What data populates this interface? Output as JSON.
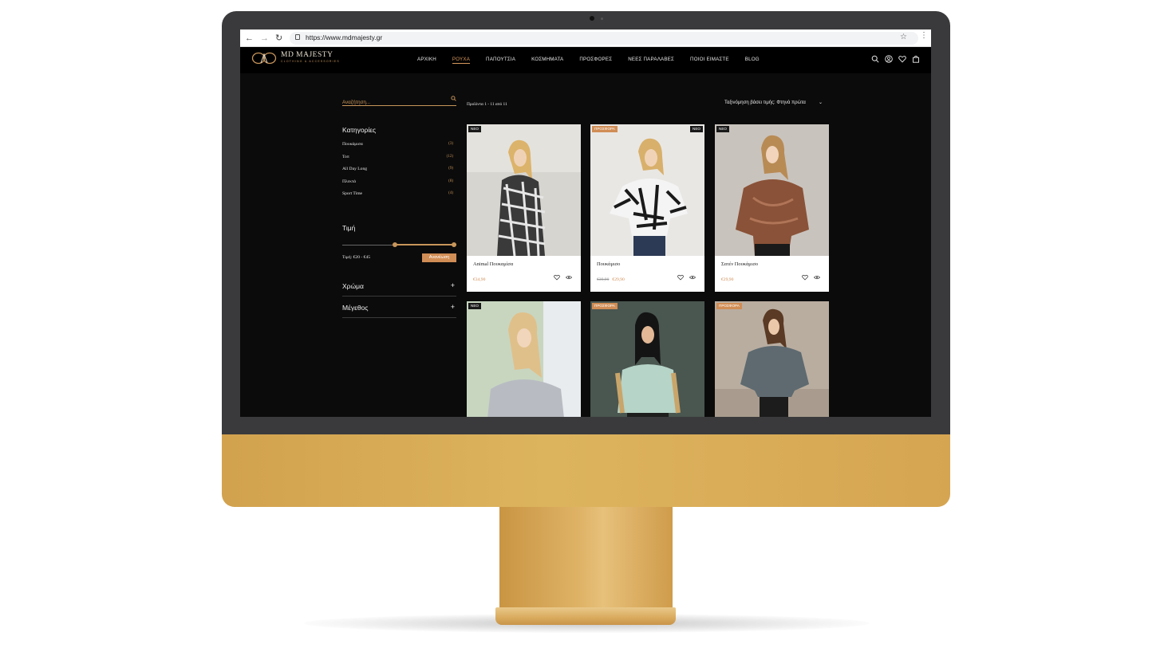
{
  "browser": {
    "url": "https://www.mdmajesty.gr"
  },
  "site": {
    "logo_text": "MD MAJESTY",
    "logo_sub": "CLOTHING & ACCESSORIES",
    "nav": [
      {
        "label": "ΑΡΧΙΚΗ",
        "active": false
      },
      {
        "label": "ΡΟΥΧΑ",
        "active": true
      },
      {
        "label": "ΠΑΠΟΥΤΣΙΑ",
        "active": false
      },
      {
        "label": "ΚΟΣΜΗΜΑΤΑ",
        "active": false
      },
      {
        "label": "ΠΡΟΣΦΟΡΕΣ",
        "active": false
      },
      {
        "label": "ΝΕΕΣ ΠΑΡΑΛΑΒΕΣ",
        "active": false
      },
      {
        "label": "ΠΟΙΟΙ ΕΙΜΑΣΤΕ",
        "active": false
      },
      {
        "label": "BLOG",
        "active": false
      }
    ],
    "accent": "#d08d55"
  },
  "sidebar": {
    "search_placeholder": "Αναζήτηση...",
    "categories_title": "Κατηγορίες",
    "categories": [
      {
        "label": "Πουκάμισα",
        "count": "(3)"
      },
      {
        "label": "Τοπ",
        "count": "(12)"
      },
      {
        "label": "All Day Long",
        "count": "(9)"
      },
      {
        "label": "Πλεκτά",
        "count": "(8)"
      },
      {
        "label": "Sport Time",
        "count": "(4)"
      }
    ],
    "price_title": "Τιμή",
    "price_range_text": "Τιμή: €20 - €45",
    "price_slider": {
      "min_fraction": 0.46,
      "max_fraction": 1.0
    },
    "refresh_label": "Ανανέωση",
    "color_label": "Χρώμα",
    "size_label": "Μέγεθος",
    "plus": "+"
  },
  "listing": {
    "results_text": "Προϊόντα 1 - 11 από 11",
    "sort_text": "Ταξινόμηση βάσει τιμής: Φτηνά πρώτα",
    "products": [
      {
        "name": "Animal Πουκαμίσα",
        "old_price": "",
        "price": "€34,90",
        "badges": [
          "ΝΕΟ"
        ]
      },
      {
        "name": "Πουκάμισο",
        "old_price": "€39,90",
        "price": "€29,90",
        "badges": [
          "ΠΡΟΣΦΟΡΑ",
          "ΝΕΟ"
        ]
      },
      {
        "name": "Σατέν Πουκάμισο",
        "old_price": "",
        "price": "€29,90",
        "badges": [
          "ΝΕΟ"
        ]
      },
      {
        "name": "",
        "old_price": "",
        "price": "",
        "badges": [
          "ΝΕΟ"
        ]
      },
      {
        "name": "",
        "old_price": "",
        "price": "",
        "badges": [
          "ΠΡΟΣΦΟΡΑ"
        ]
      },
      {
        "name": "",
        "old_price": "",
        "price": "",
        "badges": [
          "ΠΡΟΣΦΟΡΑ"
        ]
      }
    ]
  },
  "icons": [
    "back-arrow-icon",
    "forward-arrow-icon",
    "reload-icon",
    "lock-icon",
    "star-icon",
    "kebab-menu-icon",
    "search-icon",
    "user-icon",
    "heart-icon",
    "bag-icon",
    "eye-icon"
  ]
}
